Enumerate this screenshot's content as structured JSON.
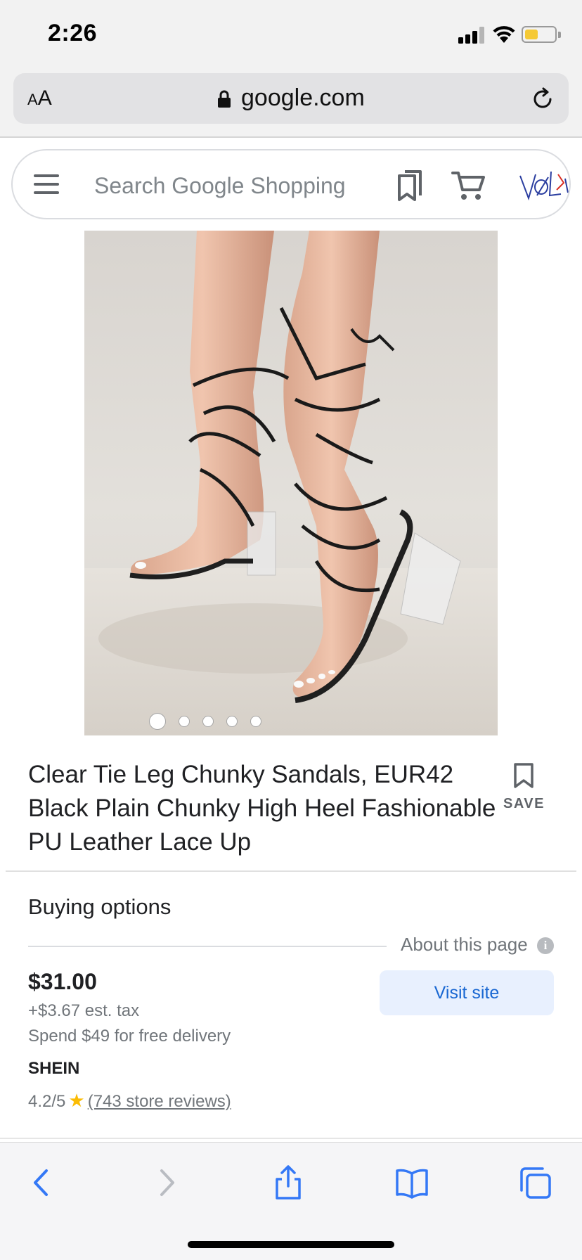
{
  "status_bar": {
    "time": "2:26"
  },
  "browser": {
    "text_size_label_small": "A",
    "text_size_label_big": "A",
    "domain": "google.com"
  },
  "search": {
    "placeholder": "Search Google Shopping",
    "icons": [
      "menu-icon",
      "saved-items-icon",
      "cart-icon",
      "account-avatar"
    ]
  },
  "gallery": {
    "image_count": 5,
    "active_index": 0
  },
  "product": {
    "title_line_1": "Clear Tie Leg Chunky Sandals, EUR42",
    "title_line_2": "Black Plain Chunky High Heel Fashionable",
    "title_line_3": "PU Leather Lace Up",
    "save_label": "SAVE"
  },
  "buying_options": {
    "heading": "Buying options",
    "about_label": "About this page",
    "info_glyph": "i",
    "price": "$31.00",
    "tax": "+$3.67 est. tax",
    "delivery": "Spend $49 for free delivery",
    "store": "SHEIN",
    "rating": "4.2/5",
    "star": "★",
    "reviews": "(743 store reviews)",
    "visit_label": "Visit site"
  },
  "colors": {
    "accent_blue": "#1967d2",
    "safari_blue": "#3478f6",
    "star_yellow": "#fbbc04"
  }
}
